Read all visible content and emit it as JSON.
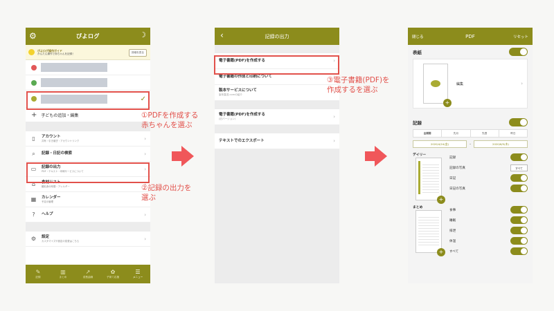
{
  "phone1": {
    "app_title": "ぴよログ",
    "guide": {
      "title": "ぴよログ操作ガイド",
      "text": "かんたん操作で赤ちゃんを記録！",
      "button": "詳細を見る"
    },
    "add_child": "子どもの追加・編集",
    "menu": [
      {
        "title": "アカウント",
        "sub": "共有・引き継ぎ・アカウントリンク",
        "icon": "phone-icon"
      },
      {
        "title": "記録・日記の検索",
        "sub": "",
        "icon": "search-icon"
      },
      {
        "title": "記録の出力",
        "sub": "PDF・テキスト・印刷サービスについて",
        "icon": "book-icon"
      },
      {
        "title": "食材リスト",
        "sub": "離乳食の時間・アレルギー",
        "icon": "tag-icon"
      },
      {
        "title": "カレンダー",
        "sub": "予定の管理",
        "icon": "calendar-icon"
      },
      {
        "title": "ヘルプ",
        "sub": "",
        "icon": "question-icon"
      }
    ],
    "settings": {
      "title": "設定",
      "sub": "カスタマイズや設定の変更はこちら"
    },
    "tabs": [
      {
        "label": "記録",
        "icon": "pencil-icon"
      },
      {
        "label": "まとめ",
        "icon": "bar-chart-icon"
      },
      {
        "label": "成長曲線",
        "icon": "growth-icon"
      },
      {
        "label": "子育て応援",
        "icon": "flower-icon"
      },
      {
        "label": "メニュー",
        "icon": "menu-icon"
      }
    ]
  },
  "phone2": {
    "title": "記録の出力",
    "rows": [
      {
        "title": "電子書籍(PDF)を作成する",
        "sub": ""
      },
      {
        "title": "電子書籍の作成と印刷について",
        "sub": ""
      },
      {
        "title": "製本サービスについて",
        "sub": "製本直送.comの紹介"
      },
      {
        "title": "電子書籍(PDF)を作成する",
        "sub": "(旧バージョン)"
      },
      {
        "title": "テキストでのエクスポート",
        "sub": ""
      }
    ]
  },
  "phone3": {
    "close": "閉じる",
    "title": "PDF",
    "reset": "リセット",
    "cover_title": "表紙",
    "edit": "編集",
    "record_title": "記録",
    "period_tabs": [
      "全期間",
      "先月",
      "先週",
      "昨日"
    ],
    "date_from": "2020/4/24(金)",
    "date_to": "2020/6/5(木)",
    "daily_label": "デイリー",
    "daily_options": [
      "記録",
      "記録の写真",
      "日記",
      "日記の写真"
    ],
    "all_button": "すべて",
    "summary_label": "まとめ",
    "summary_options": [
      "食事",
      "睡眠",
      "排泄",
      "体温",
      "すべて"
    ]
  },
  "annotations": {
    "step1": [
      "①PDFを作成する",
      "赤ちゃんを選ぶ"
    ],
    "step2": [
      "②記録の出力を",
      "選ぶ"
    ],
    "step3": [
      "③電子書籍(PDF)を",
      "作成するを選ぶ"
    ]
  },
  "colors": {
    "accent": "#8c8c1c",
    "highlight": "#e2504a",
    "arrow": "#f0575a"
  }
}
